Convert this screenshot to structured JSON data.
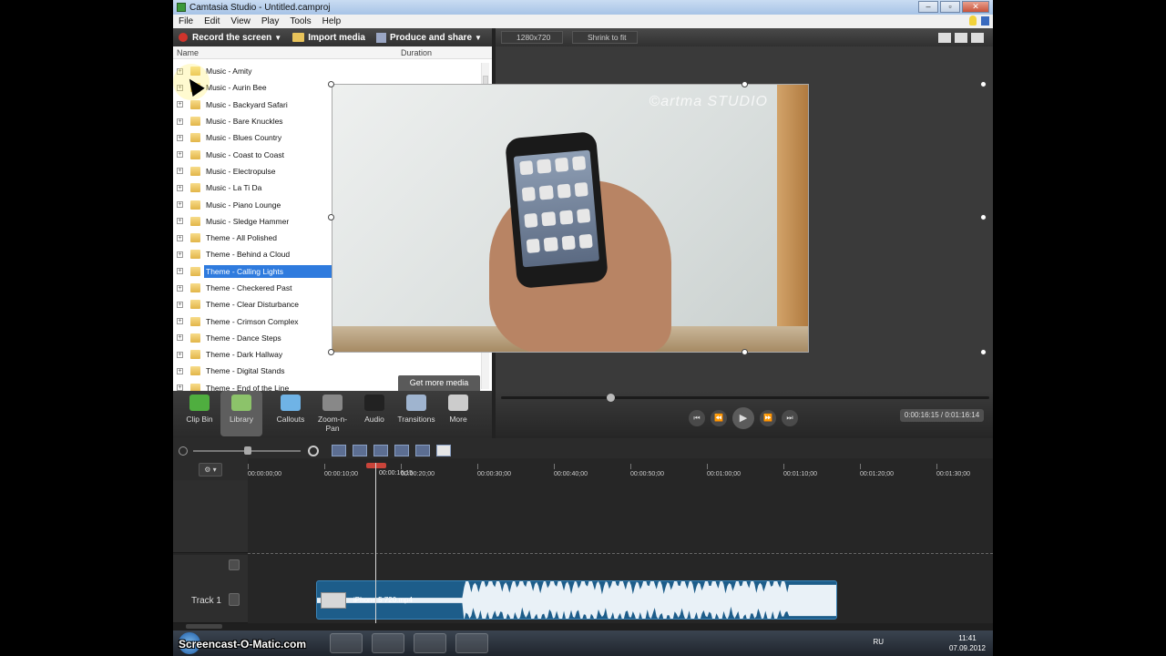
{
  "window": {
    "title": "Camtasia Studio - Untitled.camproj",
    "min": "–",
    "max": "▫",
    "close": "✕"
  },
  "menu": [
    "File",
    "Edit",
    "View",
    "Play",
    "Tools",
    "Help"
  ],
  "toolbar": {
    "record": "Record the screen",
    "import": "Import media",
    "produce": "Produce and share"
  },
  "library": {
    "col_name": "Name",
    "col_duration": "Duration",
    "items": [
      "Music - Amity",
      "Music - Aurin Bee",
      "Music - Backyard Safari",
      "Music - Bare Knuckles",
      "Music - Blues Country",
      "Music - Coast to Coast",
      "Music - Electropulse",
      "Music - La Ti Da",
      "Music - Piano Lounge",
      "Music - Sledge Hammer",
      "Theme - All Polished",
      "Theme - Behind a Cloud",
      "Theme - Calling Lights",
      "Theme - Checkered Past",
      "Theme - Clear Disturbance",
      "Theme - Crimson Complex",
      "Theme - Dance Steps",
      "Theme - Dark Hallway",
      "Theme - Digital Stands",
      "Theme - End of the Line"
    ],
    "selected_index": 12,
    "get_more": "Get more media"
  },
  "tools": [
    {
      "label": "Clip Bin",
      "color": "#4fae3f"
    },
    {
      "label": "Library",
      "color": "#8cc36a"
    },
    {
      "label": "Callouts",
      "color": "#6fb3e6"
    },
    {
      "label": "Zoom-n-Pan",
      "color": "#888888"
    },
    {
      "label": "Audio",
      "color": "#222222"
    },
    {
      "label": "Transitions",
      "color": "#9fb4cf"
    },
    {
      "label": "More",
      "color": "#cccccc"
    }
  ],
  "preview": {
    "resolution": "1280x720",
    "fit": "Shrink to fit",
    "watermark": "©artma STUDIO",
    "timecode": "0:00:16:15 / 0:01:16:14"
  },
  "transport": {
    "prev": "⏮",
    "rew": "⏪",
    "play": "▶",
    "ffw": "⏩",
    "next": "⏭"
  },
  "timeline": {
    "gear": "⚙ ▾",
    "ticks": [
      "00:00:00;00",
      "00:00:10;00",
      "00:00:20;00",
      "00:00:30;00",
      "00:00:40;00",
      "00:00:50;00",
      "00:01:00;00",
      "00:01:10;00",
      "00:01:20;00",
      "00:01:30;00"
    ],
    "playhead": "00:00:16;15",
    "track_label": "Track 1",
    "clip_name": "iPhone 5 720.mp4"
  },
  "taskbar": {
    "watermark": "Screencast-O-Matic.com",
    "lang": "RU",
    "time": "11:41",
    "date": "07.09.2012"
  }
}
